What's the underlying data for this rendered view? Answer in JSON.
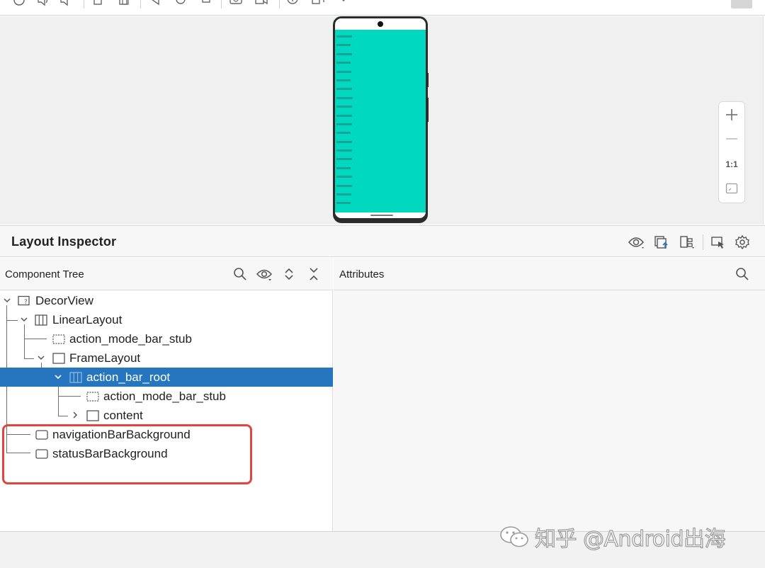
{
  "inspector": {
    "title": "Layout Inspector"
  },
  "component_tree": {
    "title": "Component Tree",
    "nodes": [
      {
        "label": "DecorView",
        "icon": "unknown-view-icon",
        "expanded": true
      },
      {
        "label": "LinearLayout",
        "icon": "linear-layout-icon",
        "expanded": true
      },
      {
        "label": "action_mode_bar_stub",
        "icon": "view-stub-icon"
      },
      {
        "label": "FrameLayout",
        "icon": "frame-layout-icon",
        "expanded": true
      },
      {
        "label": "action_bar_root",
        "icon": "linear-layout-icon",
        "expanded": true,
        "selected": true
      },
      {
        "label": "action_mode_bar_stub",
        "icon": "view-stub-icon"
      },
      {
        "label": "content",
        "icon": "frame-layout-icon",
        "expanded": false
      },
      {
        "label": "navigationBarBackground",
        "icon": "view-icon"
      },
      {
        "label": "statusBarBackground",
        "icon": "view-icon"
      }
    ]
  },
  "attributes": {
    "title": "Attributes"
  },
  "zoom": {
    "actual_size": "1:1"
  },
  "watermark": {
    "text": "知乎 @Android出海"
  },
  "colors": {
    "selection": "#2675bf",
    "highlight_box": "#e0453f",
    "device_screen": "#00d9c0"
  }
}
